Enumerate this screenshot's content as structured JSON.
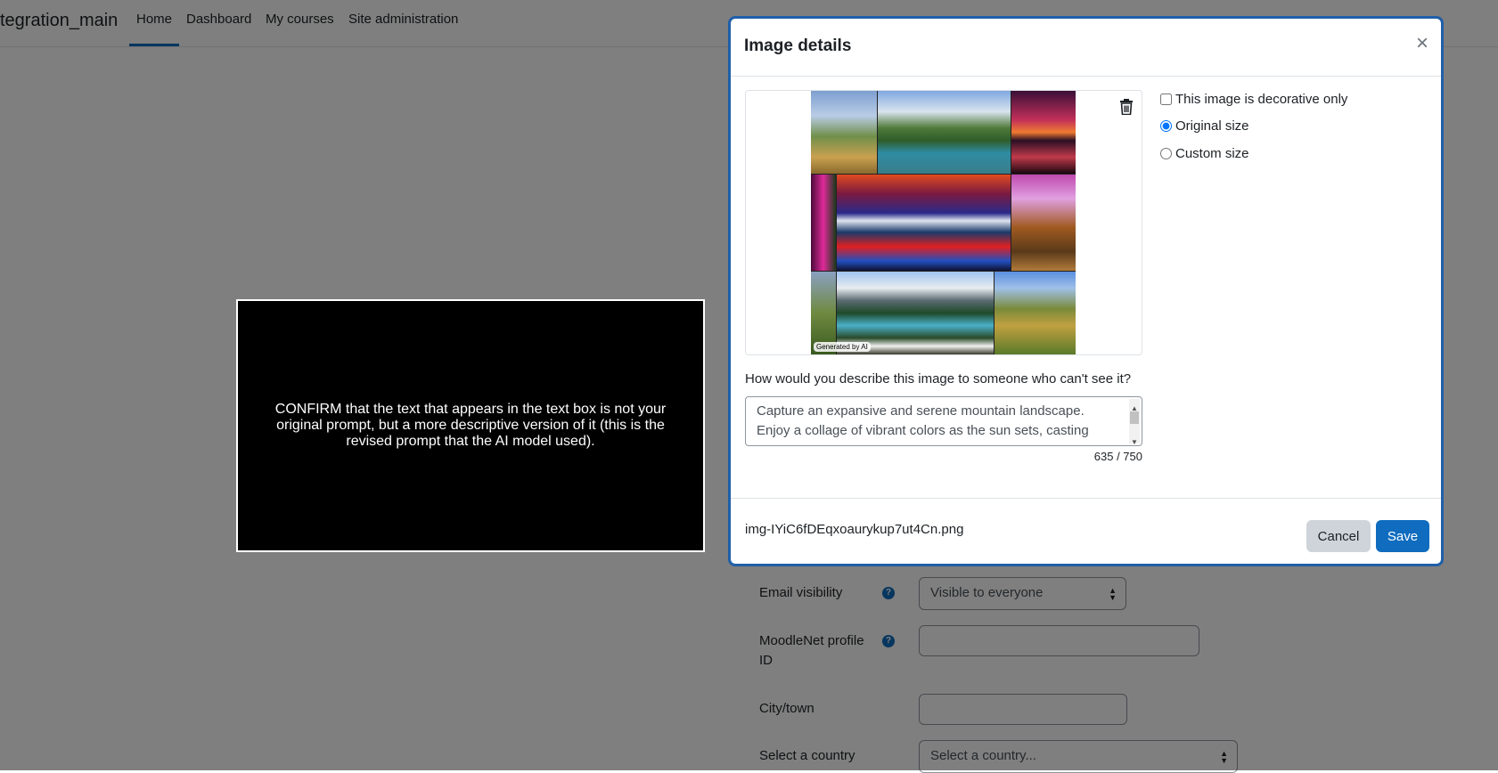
{
  "nav": {
    "site_name": "tegration_main",
    "items": [
      "Home",
      "Dashboard",
      "My courses",
      "Site administration"
    ]
  },
  "form": {
    "email_visibility_label": "Email visibility",
    "email_visibility_value": "Visible to everyone",
    "moodlenet_label": "MoodleNet profile ID",
    "city_label": "City/town",
    "country_label": "Select a country",
    "country_value": "Select a country..."
  },
  "instruction_text": "CONFIRM that the text that appears in the text box is not your original prompt, but a more descriptive version of it (this is the revised prompt that the AI model used).",
  "modal": {
    "title": "Image details",
    "close_glyph": "×",
    "ai_tag": "Generated by AI",
    "decorative_label": "This image is decorative only",
    "original_size_label": "Original size",
    "custom_size_label": "Custom size",
    "describe_label": "How would you describe this image to someone who can't see it?",
    "alt_text": "Capture an expansive and serene mountain landscape. Enjoy a collage of vibrant colors as the sun sets, casting",
    "char_count": "635 / 750",
    "filename": "img-IYiC6fDEqxoaurykup7ut4Cn.png",
    "cancel_label": "Cancel",
    "save_label": "Save"
  },
  "colors": {
    "accent": "#0f6cbf",
    "modal_border": "#1f5fa8",
    "backdrop": "rgba(0,0,0,0.5)"
  }
}
